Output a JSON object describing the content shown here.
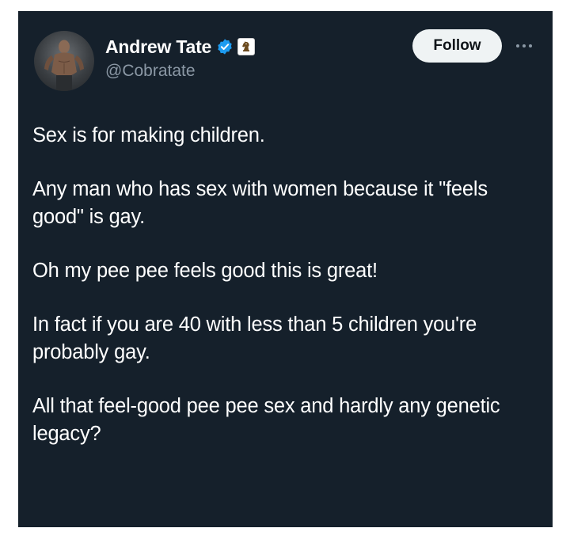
{
  "tweet": {
    "author": {
      "display_name": "Andrew Tate",
      "handle": "@Cobratate",
      "verified": true,
      "verified_color": "#1d9bf0",
      "affiliate_badge_icon": "chess-knight-icon",
      "avatar": "profile-photo"
    },
    "follow_label": "Follow",
    "more_icon": "more-horizontal-icon",
    "paragraphs": [
      "Sex is for making children.",
      "Any man who has sex with women because it \"feels good\" is gay.",
      "Oh my pee pee feels good this is great!",
      "In fact if you are 40 with less than 5 children you're probably gay.",
      "All that feel-good pee pee sex and hardly any genetic legacy?"
    ]
  },
  "colors": {
    "card_background": "#15202b",
    "text_primary": "#ffffff",
    "text_secondary": "#8b98a5",
    "follow_button_bg": "#eff3f4",
    "follow_button_text": "#0f1419"
  }
}
